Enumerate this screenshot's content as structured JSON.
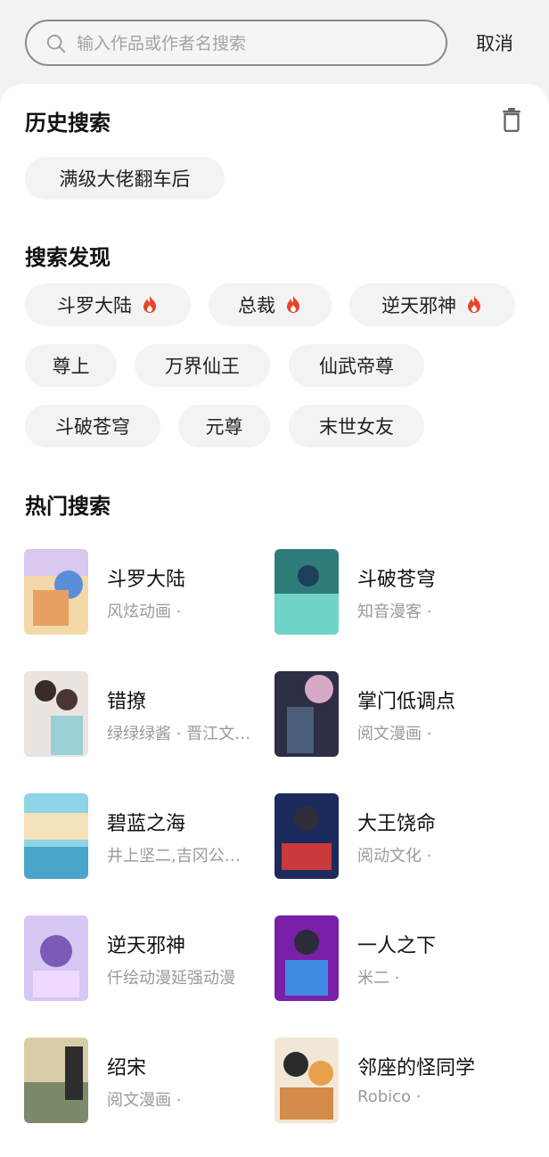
{
  "search": {
    "placeholder": "输入作品或作者名搜索",
    "cancel_label": "取消"
  },
  "history": {
    "title": "历史搜索",
    "items": [
      "满级大佬翻车后"
    ]
  },
  "discover": {
    "title": "搜索发现",
    "chips": [
      {
        "label": "斗罗大陆",
        "hot": true
      },
      {
        "label": "总裁",
        "hot": true
      },
      {
        "label": "逆天邪神",
        "hot": true
      },
      {
        "label": "尊上",
        "hot": false
      },
      {
        "label": "万界仙王",
        "hot": false
      },
      {
        "label": "仙武帝尊",
        "hot": false
      },
      {
        "label": "斗破苍穹",
        "hot": false
      },
      {
        "label": "元尊",
        "hot": false
      },
      {
        "label": "末世女友",
        "hot": false
      }
    ]
  },
  "hot": {
    "title": "热门搜索",
    "items": [
      {
        "title": "斗罗大陆",
        "subtitle": "风炫动画 ·"
      },
      {
        "title": "斗破苍穹",
        "subtitle": "知音漫客 ·"
      },
      {
        "title": "错撩",
        "subtitle": "绿绿绿酱 · 晋江文…"
      },
      {
        "title": "掌门低调点",
        "subtitle": "阅文漫画 ·"
      },
      {
        "title": "碧蓝之海",
        "subtitle": "井上坚二,吉冈公…"
      },
      {
        "title": "大王饶命",
        "subtitle": "阅动文化 ·"
      },
      {
        "title": "逆天邪神",
        "subtitle": "仟绘动漫延强动漫"
      },
      {
        "title": "一人之下",
        "subtitle": "米二 ·"
      },
      {
        "title": "绍宋",
        "subtitle": "阅文漫画 ·"
      },
      {
        "title": "邻座的怪同学",
        "subtitle": "Robico ·"
      }
    ]
  },
  "colors": {
    "fire": "#e8452c",
    "chip_bg": "#f3f3f3",
    "subtitle": "#9a9a9a"
  }
}
